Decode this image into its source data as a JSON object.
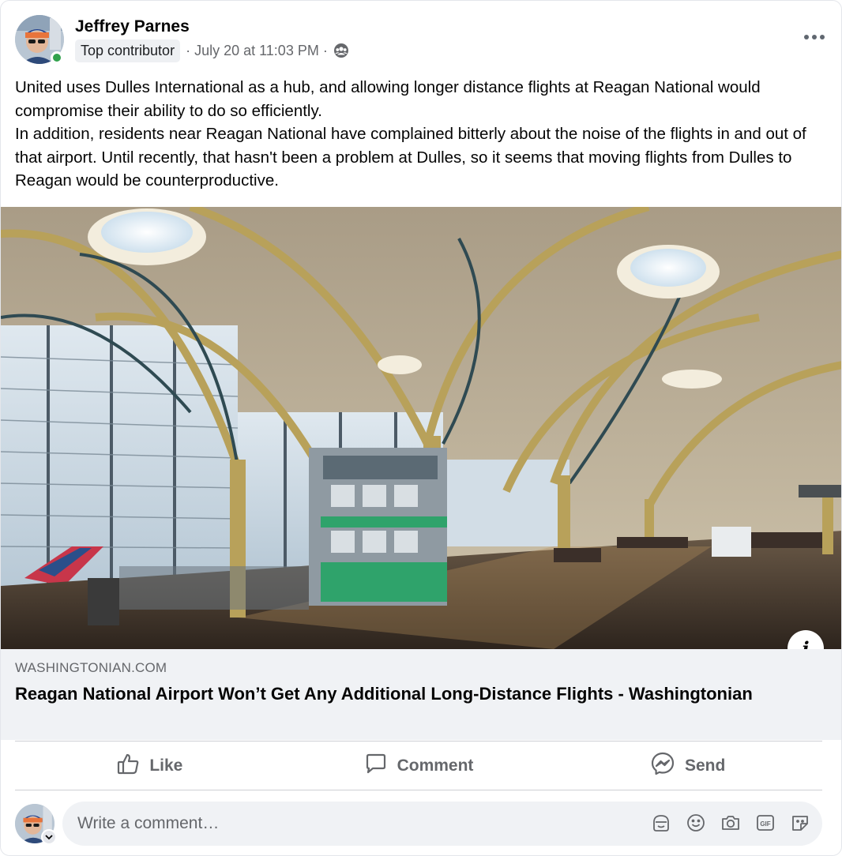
{
  "post": {
    "author_name": "Jeffrey Parnes",
    "badge": "Top contributor",
    "meta": "· July 20 at 11:03 PM ·",
    "audience_icon": "group-icon",
    "more_icon": "more-options-icon",
    "body_paragraphs": [
      "United uses Dulles International as a hub, and allowing longer distance flights at Reagan National would compromise their ability to do so efficiently.",
      "In addition, residents near Reagan National have complained bitterly about the noise of the flights in and out of that airport. Until recently, that hasn't been a problem at Dulles, so it seems that moving flights from Dulles to Reagan would be counterproductive."
    ]
  },
  "link_preview": {
    "domain": "WASHINGTONIAN.COM",
    "title": "Reagan National Airport Won’t Get Any Additional Long-Distance Flights - Washingtonian",
    "info_glyph": "i"
  },
  "actions": {
    "like": "Like",
    "comment": "Comment",
    "send": "Send"
  },
  "comment_box": {
    "placeholder": "Write a comment…",
    "icons": [
      "avatar-sticker-icon",
      "emoji-icon",
      "camera-icon",
      "gif-icon",
      "sticker-icon"
    ]
  },
  "colors": {
    "online": "#31a24c",
    "secondary_text": "#65676b",
    "link_bg": "#f0f2f5"
  }
}
